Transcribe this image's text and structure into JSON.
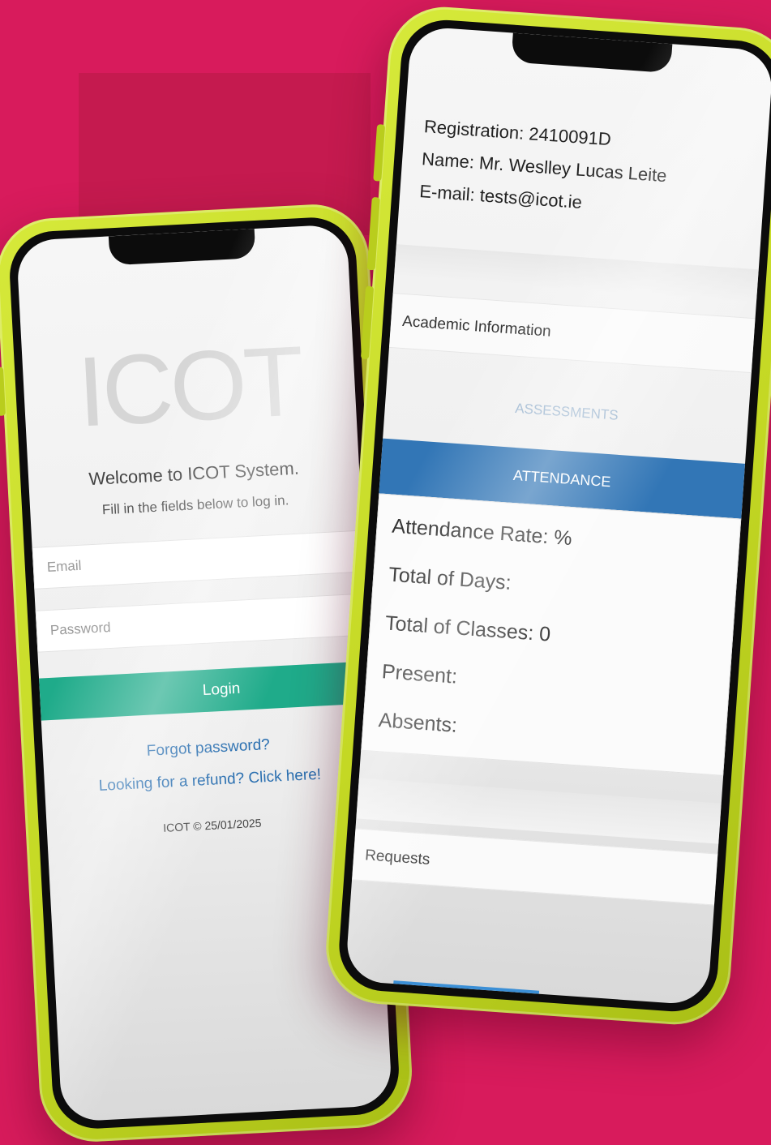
{
  "login_screen": {
    "logo": "ICOT",
    "welcome": "Welcome to ICOT System.",
    "subtitle": "Fill in the fields below to log in.",
    "email_placeholder": "Email",
    "password_placeholder": "Password",
    "login_label": "Login",
    "forgot_link": "Forgot password?",
    "refund_link": "Looking for a refund? Click here!",
    "copyright": "ICOT © 25/01/2025"
  },
  "profile_screen": {
    "registration": "Registration: 2410091D",
    "name": "Name: Mr. Weslley Lucas Leite",
    "email": "E-mail: tests@icot.ie",
    "academic_section": "Academic Information",
    "tabs": {
      "assessments": "ASSESSMENTS",
      "attendance": "ATTENDANCE"
    },
    "attendance": {
      "rate": "Attendance Rate: %",
      "days": "Total of Days:",
      "classes": "Total of Classes: 0",
      "present": "Present:",
      "absents": "Absents:"
    },
    "requests_section": "Requests"
  },
  "colors": {
    "background": "#d81b5c",
    "phone_frame": "#c4d824",
    "login_button": "#1fab8a",
    "link": "#2a6fb0",
    "attendance_tab": "#3276b6"
  }
}
